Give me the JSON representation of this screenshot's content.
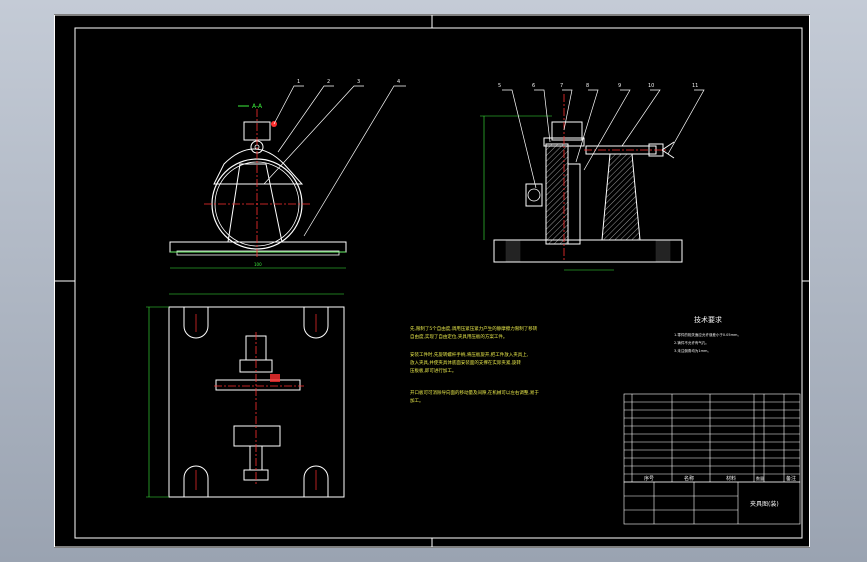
{
  "drawing": {
    "balloons_front": [
      "1",
      "2",
      "3",
      "4"
    ],
    "balloons_side": [
      "5",
      "6",
      "7",
      "8",
      "9",
      "10",
      "11"
    ],
    "section_label": "A-A",
    "notes_heading": "技术要求",
    "notes_body": [
      "先,限制了5个自由度,调用压紧压紧力产生的静摩擦力限制了移转",
      "自由度,实现了自由定位,夹具用压板的方案工件。",
      "安装工件时,先旋转螺杆手柄,将压板旋开,把工件放入夹具上,",
      "放入夹具,并使夹具体底面安装面的支撑在实际夹紧,旋转",
      "压板板,即可进行加工。",
      "开口板可可消除导向面的移动量及间隙,在机械可以左右调整,易于",
      "加工。"
    ],
    "tech_requirements": [
      "1.零件的相关面应允许误差小于0.05mm。",
      "2.铸件不允许有气孔。",
      "3.未注倒角均为1mm。"
    ],
    "parts_table_headers": [
      "序号",
      "名称",
      "材料",
      "数量",
      "备注"
    ],
    "title_block_name": "夹具图(装)",
    "dim_overall": "100"
  }
}
